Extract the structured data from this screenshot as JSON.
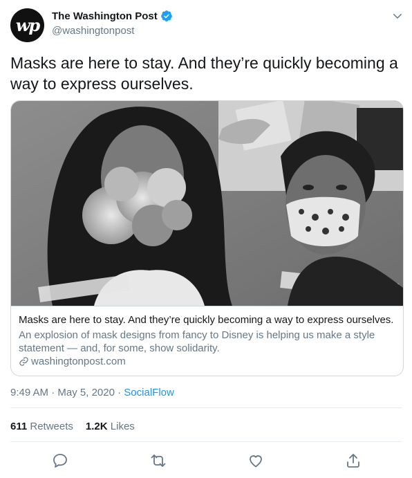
{
  "author": {
    "name": "The Washington Post",
    "handle": "@washingtonpost",
    "avatar_text": "wp"
  },
  "tweet": {
    "text": "Masks are here to stay. And they’re quickly becoming a way to express ourselves."
  },
  "card": {
    "title": "Masks are here to stay. And they’re quickly becoming a way to express ourselves.",
    "description": "An explosion of mask designs from fancy to Disney is helping us make a style statement — and, for some, show solidarity.",
    "domain": "washingtonpost.com"
  },
  "meta": {
    "time": "9:49 AM",
    "separator1": "·",
    "date": "May 5, 2020",
    "separator2": "·",
    "source": "SocialFlow"
  },
  "stats": {
    "retweets_count": "611",
    "retweets_label": "Retweets",
    "likes_count": "1.2K",
    "likes_label": "Likes"
  },
  "icons": {
    "verified": "verified-badge-icon",
    "chevron": "chevron-down-icon",
    "link": "link-icon",
    "reply": "reply-icon",
    "retweet": "retweet-icon",
    "like": "heart-icon",
    "share": "share-icon"
  },
  "colors": {
    "accent": "#1da1f2",
    "link": "#1b95e0",
    "muted": "#657786",
    "text": "#14171a"
  }
}
